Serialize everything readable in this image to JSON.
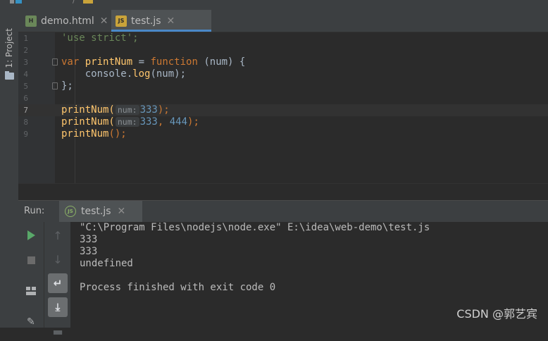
{
  "tabs": [
    {
      "label": "demo.html",
      "icon": "html-file-icon",
      "active": false
    },
    {
      "label": "test.js",
      "icon": "js-file-icon",
      "active": true
    }
  ],
  "tool_window": {
    "project_label": "1: Project"
  },
  "editor": {
    "line_numbers": [
      "1",
      "2",
      "3",
      "4",
      "5",
      "6",
      "7",
      "8",
      "9"
    ],
    "current_line": 7,
    "lines": {
      "l1": {
        "str": "'use strict';"
      },
      "l3": {
        "kw_var": "var",
        "name": "printNum",
        "eq": " = ",
        "kw_function": "function",
        "params": " (num) {"
      },
      "l4": {
        "obj": "console.",
        "method": "log",
        "args": "(num);"
      },
      "l5": {
        "close": "};"
      },
      "l7": {
        "call": "printNum(",
        "hint": "num:",
        "val": "333",
        "end": ");"
      },
      "l8": {
        "call": "printNum(",
        "hint": "num:",
        "val1": "333",
        "comma": ", ",
        "val2": "444",
        "end": ");"
      },
      "l9": {
        "call": "printNum",
        "end": "();"
      }
    }
  },
  "run": {
    "label": "Run:",
    "tab_label": "test.js",
    "output": [
      "\"C:\\Program Files\\nodejs\\node.exe\" E:\\idea\\web-demo\\test.js",
      "333",
      "333",
      "undefined",
      "",
      "Process finished with exit code 0"
    ]
  },
  "watermark": "CSDN @郭艺宾",
  "colors": {
    "keyword": "#cc7832",
    "string": "#6a8759",
    "function": "#ffc66d",
    "number": "#6897bb",
    "active_tab_underline": "#4a88c7",
    "run_green": "#59a869"
  }
}
